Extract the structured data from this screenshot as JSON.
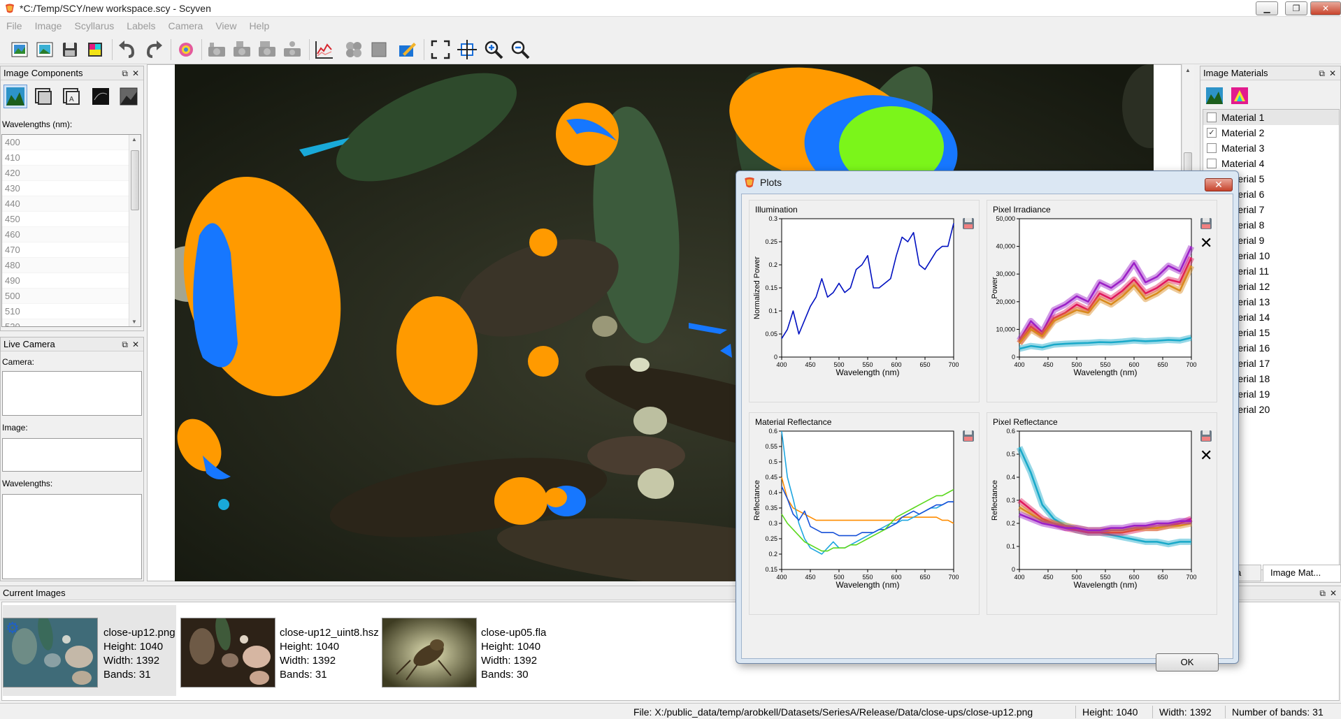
{
  "window": {
    "title": "*C:/Temp/SCY/new workspace.scy - Scyven",
    "minimize": "▁",
    "restore": "❐",
    "close": "✕"
  },
  "menu": [
    "File",
    "Image",
    "Scyllarus",
    "Labels",
    "Camera",
    "View",
    "Help"
  ],
  "image_components": {
    "title": "Image Components",
    "wavelengths_label": "Wavelengths (nm):",
    "wavelengths": [
      "400",
      "410",
      "420",
      "430",
      "440",
      "450",
      "460",
      "470",
      "480",
      "490",
      "500",
      "510",
      "520"
    ]
  },
  "live_camera": {
    "title": "Live Camera",
    "camera_label": "Camera:",
    "image_label": "Image:",
    "wavelengths_label": "Wavelengths:"
  },
  "image_materials": {
    "title": "Image Materials",
    "materials": [
      "Material 1",
      "Material 2",
      "Material 3",
      "Material 4",
      "Material 5",
      "Material 6",
      "Material 7",
      "Material 8",
      "Material 9",
      "Material 10",
      "Material 11",
      "Material 12",
      "Material 13",
      "Material 14",
      "Material 15",
      "Material 16",
      "Material 17",
      "Material 18",
      "Material 19",
      "Material 20"
    ],
    "checked": [
      false,
      true,
      false,
      false,
      false,
      false,
      false,
      false,
      false,
      false,
      false,
      false,
      false,
      false,
      false,
      false,
      false,
      false,
      false,
      false
    ]
  },
  "tabs": {
    "left": "Camera L...",
    "right": "Image Mat..."
  },
  "current_images": {
    "title": "Current Images",
    "items": [
      {
        "name": "close-up12.png",
        "height": "Height: 1040",
        "width": "Width: 1392",
        "bands": "Bands: 31"
      },
      {
        "name": "close-up12_uint8.hsz",
        "height": "Height: 1040",
        "width": "Width: 1392",
        "bands": "Bands: 31"
      },
      {
        "name": "close-up05.fla",
        "height": "Height: 1040",
        "width": "Width: 1392",
        "bands": "Bands: 30"
      }
    ]
  },
  "status": {
    "file": "File: X:/public_data/temp/arobkell/Datasets/SeriesA/Release/Data/close-ups/close-up12.png",
    "height": "Height: 1040",
    "width": "Width: 1392",
    "bands": "Number of bands: 31"
  },
  "plots_dialog": {
    "title": "Plots",
    "ok_label": "OK",
    "close_label": "✕",
    "remove_glyph": "✕"
  },
  "colors": {
    "orange": "#ff9a00",
    "blue": "#1677ff",
    "green": "#7bf51a",
    "cyan": "#19a9d8"
  },
  "chart_data": [
    {
      "type": "line",
      "title": "Illumination",
      "xlabel": "Wavelength (nm)",
      "ylabel": "Normalized Power",
      "xlim": [
        400,
        700
      ],
      "ylim": [
        0,
        0.3
      ],
      "xticks": [
        400,
        450,
        500,
        550,
        600,
        650,
        700
      ],
      "yticks": [
        0,
        0.05,
        0.1,
        0.15,
        0.2,
        0.25,
        0.3
      ],
      "x": [
        400,
        410,
        420,
        430,
        440,
        450,
        460,
        470,
        480,
        490,
        500,
        510,
        520,
        530,
        540,
        550,
        560,
        570,
        580,
        590,
        600,
        610,
        620,
        630,
        640,
        650,
        660,
        670,
        680,
        690,
        700
      ],
      "series": [
        {
          "values": [
            0.04,
            0.06,
            0.1,
            0.05,
            0.08,
            0.11,
            0.13,
            0.17,
            0.13,
            0.14,
            0.16,
            0.14,
            0.15,
            0.19,
            0.2,
            0.22,
            0.15,
            0.15,
            0.16,
            0.17,
            0.22,
            0.26,
            0.25,
            0.27,
            0.2,
            0.19,
            0.21,
            0.23,
            0.24,
            0.24,
            0.29
          ],
          "color": "#0010c0"
        }
      ]
    },
    {
      "type": "line",
      "title": "Pixel Irradiance",
      "xlabel": "Wavelength (nm)",
      "ylabel": "Power",
      "xlim": [
        400,
        700
      ],
      "ylim": [
        0,
        50000
      ],
      "xticks": [
        400,
        450,
        500,
        550,
        600,
        650,
        700
      ],
      "yticks": [
        0,
        10000,
        20000,
        30000,
        40000,
        50000
      ],
      "yticklabels": [
        "0",
        "10,000",
        "20,000",
        "30,000",
        "40,000",
        "50,000"
      ],
      "x": [
        400,
        420,
        440,
        460,
        480,
        500,
        520,
        540,
        560,
        580,
        600,
        620,
        640,
        660,
        680,
        700
      ],
      "series": [
        {
          "values": [
            6000,
            13000,
            9000,
            17000,
            19000,
            22000,
            20000,
            27000,
            25000,
            28000,
            34000,
            27000,
            29000,
            33000,
            31000,
            40000
          ],
          "color": "#9b1fc7"
        },
        {
          "values": [
            5000,
            11000,
            8000,
            14000,
            16000,
            19000,
            17000,
            23000,
            21000,
            24000,
            28000,
            23000,
            25000,
            28000,
            27000,
            36000
          ],
          "color": "#e0185b"
        },
        {
          "values": [
            5000,
            10000,
            7500,
            13000,
            15000,
            17000,
            16000,
            21000,
            19000,
            22000,
            26000,
            21000,
            23000,
            26000,
            24000,
            33000
          ],
          "color": "#d98a1d"
        },
        {
          "values": [
            3000,
            4000,
            3500,
            4500,
            4800,
            5000,
            5100,
            5400,
            5300,
            5600,
            6000,
            5700,
            5900,
            6200,
            6000,
            7000
          ],
          "color": "#19a9c9"
        }
      ]
    },
    {
      "type": "line",
      "title": "Material Reflectance",
      "xlabel": "Wavelength (nm)",
      "ylabel": "Reflectance",
      "xlim": [
        400,
        700
      ],
      "ylim": [
        0.15,
        0.6
      ],
      "xticks": [
        400,
        450,
        500,
        550,
        600,
        650,
        700
      ],
      "yticks": [
        0.15,
        0.2,
        0.25,
        0.3,
        0.35,
        0.4,
        0.45,
        0.5,
        0.55,
        0.6
      ],
      "x": [
        400,
        410,
        420,
        430,
        440,
        450,
        460,
        470,
        480,
        490,
        500,
        510,
        520,
        530,
        540,
        550,
        560,
        570,
        580,
        590,
        600,
        610,
        620,
        630,
        640,
        650,
        660,
        670,
        680,
        690,
        700
      ],
      "series": [
        {
          "values": [
            0.45,
            0.38,
            0.35,
            0.34,
            0.33,
            0.32,
            0.31,
            0.31,
            0.31,
            0.31,
            0.31,
            0.31,
            0.31,
            0.31,
            0.31,
            0.31,
            0.31,
            0.31,
            0.31,
            0.31,
            0.31,
            0.32,
            0.32,
            0.32,
            0.32,
            0.32,
            0.32,
            0.32,
            0.31,
            0.31,
            0.3
          ],
          "color": "#ff8c00"
        },
        {
          "values": [
            0.6,
            0.45,
            0.38,
            0.3,
            0.25,
            0.22,
            0.21,
            0.2,
            0.22,
            0.24,
            0.22,
            0.22,
            0.23,
            0.24,
            0.25,
            0.26,
            0.27,
            0.28,
            0.29,
            0.3,
            0.3,
            0.31,
            0.31,
            0.32,
            0.33,
            0.34,
            0.35,
            0.35,
            0.36,
            0.37,
            0.37
          ],
          "color": "#1fa6e0"
        },
        {
          "values": [
            0.42,
            0.38,
            0.33,
            0.31,
            0.34,
            0.29,
            0.28,
            0.27,
            0.27,
            0.27,
            0.26,
            0.26,
            0.26,
            0.26,
            0.27,
            0.27,
            0.27,
            0.28,
            0.28,
            0.29,
            0.3,
            0.32,
            0.33,
            0.34,
            0.33,
            0.34,
            0.35,
            0.36,
            0.36,
            0.37,
            0.37
          ],
          "color": "#1650d8"
        },
        {
          "values": [
            0.33,
            0.3,
            0.28,
            0.26,
            0.24,
            0.23,
            0.22,
            0.21,
            0.21,
            0.22,
            0.22,
            0.22,
            0.23,
            0.23,
            0.24,
            0.25,
            0.26,
            0.27,
            0.28,
            0.3,
            0.32,
            0.33,
            0.34,
            0.35,
            0.36,
            0.37,
            0.38,
            0.39,
            0.39,
            0.4,
            0.41
          ],
          "color": "#5ad81c"
        }
      ]
    },
    {
      "type": "line",
      "title": "Pixel Reflectance",
      "xlabel": "Wavelength (nm)",
      "ylabel": "Reflectance",
      "xlim": [
        400,
        700
      ],
      "ylim": [
        0,
        0.6
      ],
      "xticks": [
        400,
        450,
        500,
        550,
        600,
        650,
        700
      ],
      "yticks": [
        0,
        0.1,
        0.2,
        0.3,
        0.4,
        0.5,
        0.6
      ],
      "x": [
        400,
        420,
        440,
        460,
        480,
        500,
        520,
        540,
        560,
        580,
        600,
        620,
        640,
        660,
        680,
        700
      ],
      "series": [
        {
          "values": [
            0.53,
            0.42,
            0.28,
            0.22,
            0.19,
            0.17,
            0.16,
            0.16,
            0.15,
            0.14,
            0.13,
            0.12,
            0.12,
            0.11,
            0.12,
            0.12
          ],
          "color": "#19a9c9"
        },
        {
          "values": [
            0.3,
            0.26,
            0.22,
            0.2,
            0.18,
            0.17,
            0.16,
            0.16,
            0.16,
            0.16,
            0.17,
            0.18,
            0.18,
            0.19,
            0.2,
            0.22
          ],
          "color": "#e0185b"
        },
        {
          "values": [
            0.27,
            0.24,
            0.21,
            0.2,
            0.19,
            0.18,
            0.17,
            0.17,
            0.17,
            0.17,
            0.18,
            0.18,
            0.18,
            0.19,
            0.19,
            0.2
          ],
          "color": "#d98a1d"
        },
        {
          "values": [
            0.24,
            0.22,
            0.2,
            0.19,
            0.18,
            0.18,
            0.17,
            0.17,
            0.18,
            0.18,
            0.19,
            0.19,
            0.2,
            0.2,
            0.21,
            0.21
          ],
          "color": "#9b1fc7"
        }
      ]
    }
  ]
}
